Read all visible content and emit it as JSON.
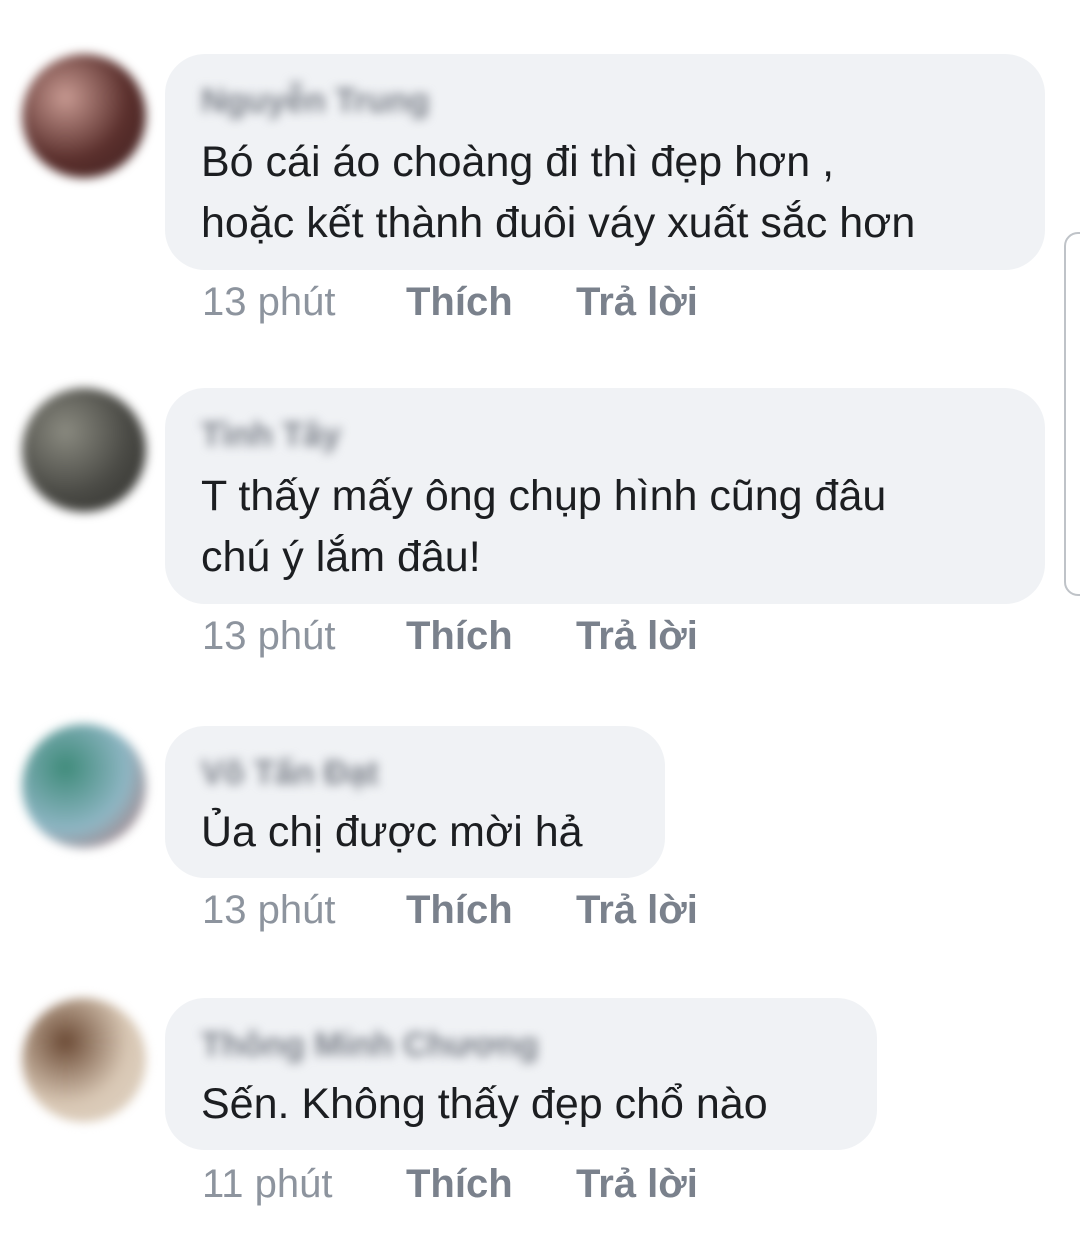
{
  "comments": [
    {
      "author": "Nguyễn Trung",
      "lines": [
        "Bó cái áo choàng đi thì đẹp hơn ,",
        "hoặc kết thành đuôi váy xuất sắc hơn"
      ],
      "time": "13 phút",
      "like_label": "Thích",
      "reply_label": "Trả lời",
      "avatar_colors": [
        "#5a2f2c",
        "#c89a92",
        "#3d2020"
      ]
    },
    {
      "author": "Tình Tây",
      "lines": [
        "T thấy mấy ông chụp hình cũng đâu",
        "chú ý lắm đâu!"
      ],
      "time": "13 phút",
      "like_label": "Thích",
      "reply_label": "Trả lời",
      "avatar_colors": [
        "#4a4a45",
        "#8a8a80",
        "#2e2e2b"
      ]
    },
    {
      "author": "Võ Tấn Đạt",
      "lines": [
        "Ủa chị được mời hả"
      ],
      "time": "13 phút",
      "like_label": "Thích",
      "reply_label": "Trả lời",
      "avatar_colors": [
        "#8fb6c4",
        "#3f8b7a",
        "#b36a6a"
      ]
    },
    {
      "author": "Thông Minh Chương",
      "lines": [
        "Sến. Không thấy đẹp chổ nào"
      ],
      "time": "11 phút",
      "like_label": "Thích",
      "reply_label": "Trả lời",
      "avatar_colors": [
        "#d8c7b4",
        "#6b4a35",
        "#e2d6c6"
      ]
    }
  ]
}
